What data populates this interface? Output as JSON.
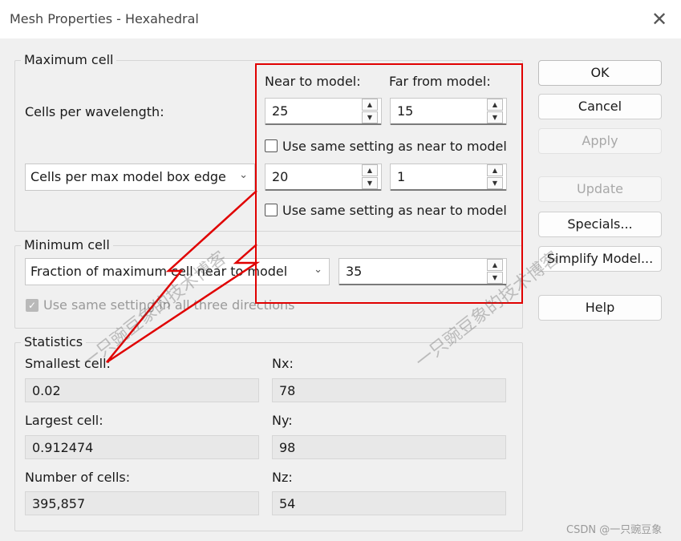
{
  "window": {
    "title": "Mesh Properties - Hexahedral",
    "close_glyph": "✕"
  },
  "max_cell": {
    "legend": "Maximum cell",
    "near_label": "Near to model:",
    "far_label": "Far from model:",
    "row1_label": "Cells per wavelength:",
    "row1_near": "25",
    "row1_far": "15",
    "same_setting_1": "Use same setting as near to model",
    "row2_select": "Cells per max model box edge",
    "row2_near": "20",
    "row2_far": "1",
    "same_setting_2": "Use same setting as near to model"
  },
  "min_cell": {
    "legend": "Minimum cell",
    "select": "Fraction of maximum cell near to model",
    "value": "35",
    "all_dirs": "Use same setting in all three directions"
  },
  "stats": {
    "legend": "Statistics",
    "smallest_label": "Smallest cell:",
    "smallest_value": "0.02",
    "largest_label": "Largest cell:",
    "largest_value": "0.912474",
    "count_label": "Number of cells:",
    "count_value": "395,857",
    "nx_label": "Nx:",
    "nx_value": "78",
    "ny_label": "Ny:",
    "ny_value": "98",
    "nz_label": "Nz:",
    "nz_value": "54"
  },
  "buttons": {
    "ok": "OK",
    "cancel": "Cancel",
    "apply": "Apply",
    "update": "Update",
    "specials": "Specials...",
    "simplify": "Simplify Model...",
    "help": "Help"
  },
  "watermark": {
    "text": "一只豌豆象的技术博客",
    "credit": "CSDN @一只豌豆象"
  },
  "colors": {
    "annotation": "#e00000",
    "window_bg": "#f0f0f0"
  },
  "icons": {
    "spin_up": "▲",
    "spin_down": "▼",
    "chevron": "⌄",
    "check": "✓"
  }
}
